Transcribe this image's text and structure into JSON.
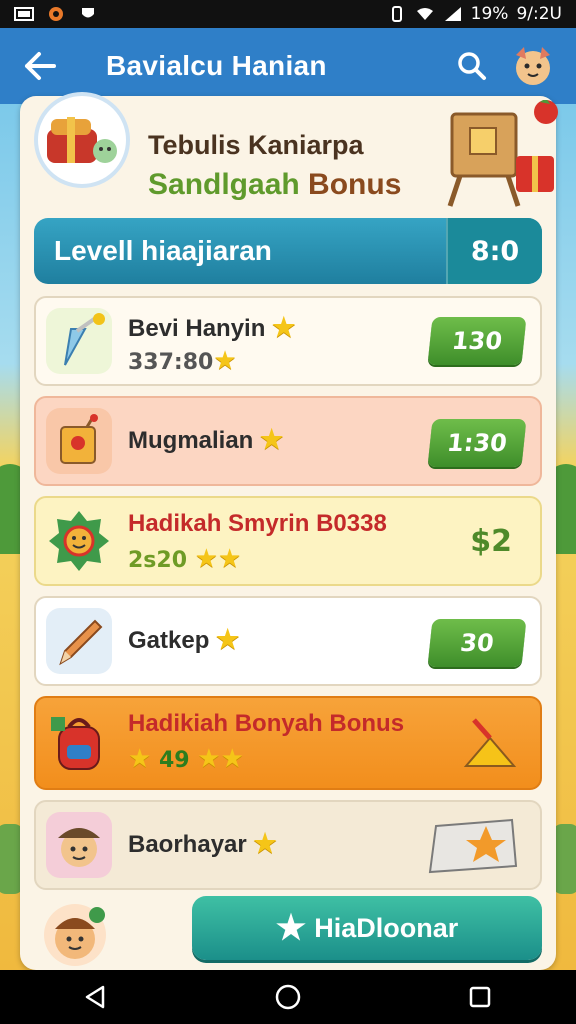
{
  "status_bar": {
    "battery": "19%",
    "time": "9/:2U",
    "icons": [
      "notification-icon",
      "gallery-icon",
      "shield-icon",
      "vibrate-icon",
      "wifi-icon",
      "signal-icon"
    ]
  },
  "app_bar": {
    "title": "Bavialcu Hanian",
    "back_icon": "back-arrow-icon",
    "search_icon": "search-icon",
    "mascot_icon": "mascot-icon"
  },
  "header": {
    "title": "Tebulis Kaniarpa",
    "subtitle_green": "Sandlgaah",
    "subtitle_brown": "Bonus"
  },
  "level": {
    "label": "Levell hiaajiaran",
    "value": "8:0"
  },
  "tasks": [
    {
      "name": "Bevi Hanyin",
      "sub": "337:80",
      "reward": "130",
      "icon": "brush-icon"
    },
    {
      "name": "Mugmalian",
      "sub": "",
      "reward": "1:30",
      "icon": "tag-icon"
    },
    {
      "name": "Hadikah Smyrin B0338",
      "sub": "2s20",
      "reward": "$2",
      "icon": "badge-icon"
    },
    {
      "name": "Gatkep",
      "sub": "",
      "reward": "30",
      "icon": "pencil-icon"
    },
    {
      "name": "Hadikiah Bonyah Bonus",
      "sub": "49",
      "reward": "",
      "icon": "backpack-icon"
    },
    {
      "name": "Baorhayar",
      "sub": "",
      "reward": "",
      "icon": "avatar-icon"
    }
  ],
  "primary_button": {
    "label": "HiaDloonar"
  },
  "colors": {
    "app_bar": "#2f7fc8",
    "level_bar": "#1f7f9f",
    "reward_green": "#4e9a2e",
    "accent_red": "#c42a2a"
  }
}
